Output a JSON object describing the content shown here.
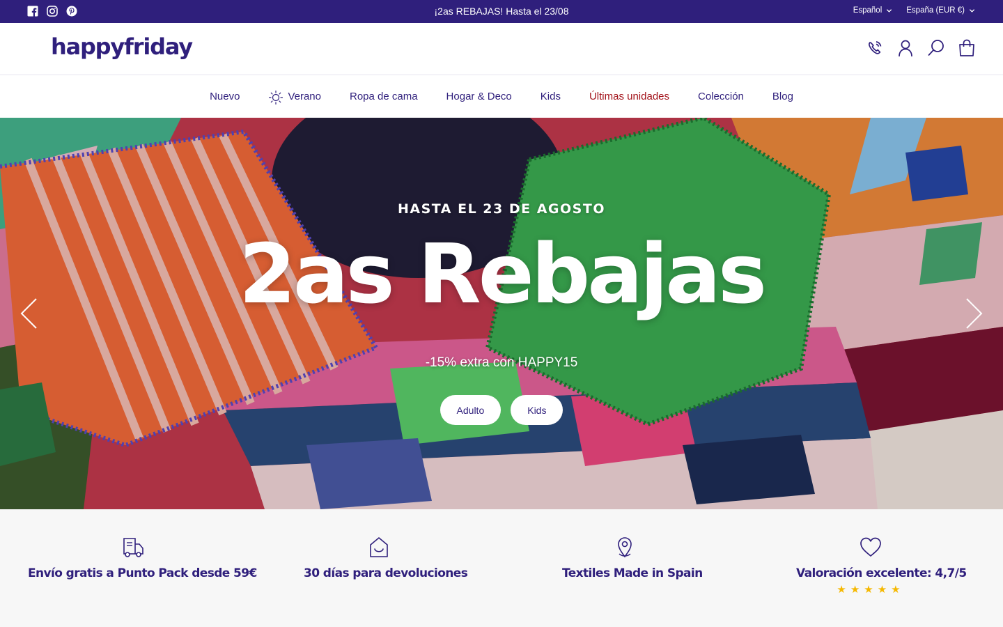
{
  "announcement": {
    "promo_text": "¡2as REBAJAS! Hasta el 23/08",
    "socials": [
      "facebook-icon",
      "instagram-icon",
      "pinterest-icon"
    ],
    "language": "Español",
    "country_currency": "España (EUR €)"
  },
  "header": {
    "logo": "happyfriday",
    "icons": [
      "phone-icon",
      "account-icon",
      "search-icon",
      "cart-icon"
    ]
  },
  "nav": {
    "items": [
      {
        "label": "Nuevo"
      },
      {
        "label": "Verano",
        "icon": "sun-icon"
      },
      {
        "label": "Ropa de cama"
      },
      {
        "label": "Hogar & Deco"
      },
      {
        "label": "Kids"
      },
      {
        "label": "Últimas unidades",
        "highlight": true
      },
      {
        "label": "Colección"
      },
      {
        "label": "Blog"
      }
    ]
  },
  "hero": {
    "eyebrow": "HASTA EL 23 DE AGOSTO",
    "headline": "2as Rebajas",
    "subtitle": "-15% extra con HAPPY15",
    "buttons": [
      "Adulto",
      "Kids"
    ]
  },
  "features": [
    {
      "icon": "delivery-truck-icon",
      "label": "Envío gratis a Punto Pack desde 59€"
    },
    {
      "icon": "return-box-icon",
      "label": "30 días para devoluciones"
    },
    {
      "icon": "location-pin-icon",
      "label": "Textiles Made in Spain"
    },
    {
      "icon": "heart-icon",
      "label": "Valoración excelente: 4,7/5",
      "rating": 5
    }
  ],
  "colors": {
    "brand": "#2f1f7c",
    "sale": "#a3131b",
    "star": "#f5b800",
    "feature_bg": "#f7f7f7"
  }
}
